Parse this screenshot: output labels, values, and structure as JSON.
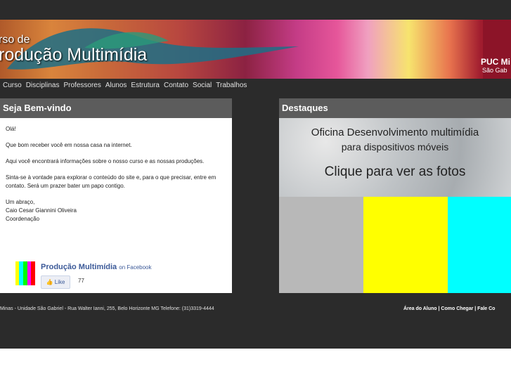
{
  "banner": {
    "title_line1": "rso de",
    "title_line2": "rodução Multimídia",
    "logo_line1": "PUC Mi",
    "logo_line2": "São Gab"
  },
  "nav": {
    "items": [
      {
        "label": "Curso"
      },
      {
        "label": "Disciplinas"
      },
      {
        "label": "Professores"
      },
      {
        "label": "Alunos"
      },
      {
        "label": "Estrutura"
      },
      {
        "label": "Contato"
      },
      {
        "label": "Social"
      },
      {
        "label": "Trabalhos"
      }
    ]
  },
  "welcome": {
    "header": "Seja Bem-vindo",
    "paragraphs": [
      "Olá!",
      "Que bom receber você em nossa casa na internet.",
      "Aqui você encontrará informações sobre o nosso curso e as nossas produções.",
      "Sinta-se à vontade para explorar o conteúdo do site e, para o que precisar, entre em contato. Será um prazer bater um papo contigo."
    ],
    "signoff_lines": [
      "Um abraço,",
      "Caio Cesar Giannini Oliveira",
      "Coordenação"
    ]
  },
  "facebook": {
    "page_name": "Produção Multimídia",
    "on_text": "on Facebook",
    "like_label": "Like",
    "like_count": "77"
  },
  "highlights": {
    "header": "Destaques",
    "promo_line1": "Oficina Desenvolvimento multimídia",
    "promo_line2": "para dispositivos móveis",
    "promo_line3": "Clique para ver as fotos",
    "bar_colors": [
      "#b8b8b8",
      "#ffff00",
      "#00ffff"
    ]
  },
  "footer": {
    "address": "Minas - Unidade São Gabriel - Rua Walter Ianni, 255, Belo Horizonte MG Telefone: (31)3319-4444",
    "links": "Área do Aluno | Como Chegar | Fale Co"
  },
  "colors": {
    "accent": "#8c1428",
    "panel_header": "#5c5c5c",
    "background": "#2b2b2b"
  }
}
